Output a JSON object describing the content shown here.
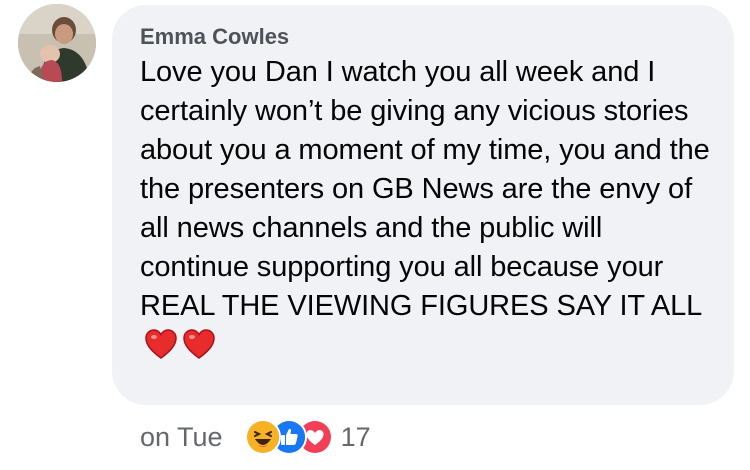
{
  "comment": {
    "author": "Emma Cowles",
    "text": "Love you Dan I watch you all week and I certainly won’t be giving any vicious stories about you a moment of my time, you and the the presenters on GB News are the envy of all news channels and the public will continue supporting you all because your REAL THE VIEWING FIGURES SAY IT ALL",
    "trailing_emojis": [
      "heart-emoji",
      "heart-emoji"
    ]
  },
  "footer": {
    "timestamp": "on Tue",
    "reactions": [
      "haha-reaction-icon",
      "like-reaction-icon",
      "love-reaction-icon"
    ],
    "reaction_count": "17"
  },
  "colors": {
    "bubble": "#f0f2f5",
    "author": "#4f5358",
    "text": "#050505",
    "meta": "#65676b",
    "like": "#1877f2",
    "love": "#f33e58",
    "haha": "#f7b125"
  }
}
